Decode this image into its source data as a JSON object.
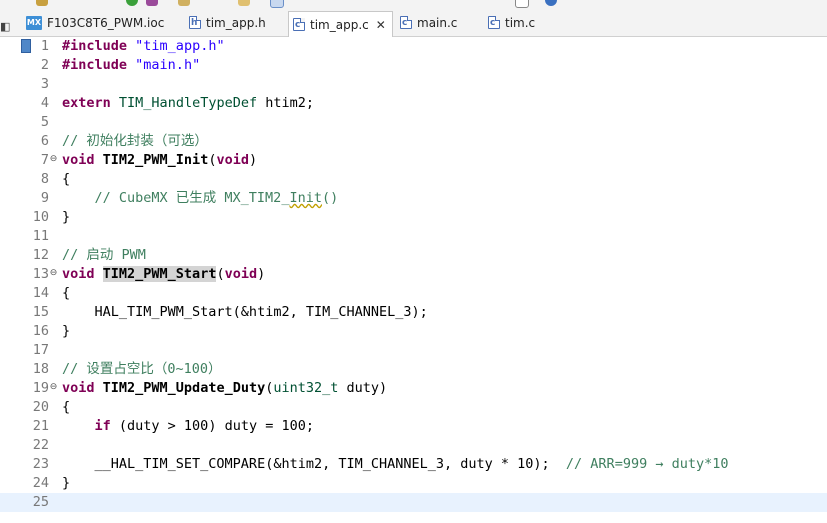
{
  "tabs": [
    {
      "label": "F103C8T6_PWM.ioc",
      "icon": "mx-icon",
      "active": false
    },
    {
      "label": "tim_app.h",
      "icon": "h-file-icon",
      "active": false
    },
    {
      "label": "tim_app.c",
      "icon": "c-file-icon",
      "active": true
    },
    {
      "label": "main.c",
      "icon": "c-file-icon",
      "active": false
    },
    {
      "label": "tim.c",
      "icon": "c-file-icon",
      "active": false
    }
  ],
  "tab_icon_letters": {
    "h": "h",
    "c": "c",
    "mx": "MX"
  },
  "close_glyph": "✕",
  "current_line": 25,
  "colors": {
    "keyword": "#7f0055",
    "string": "#2a00ff",
    "comment": "#3f7f5f",
    "type": "#005032",
    "current_line_bg": "#e8f2fe",
    "highlight_bg": "#d4d4d4"
  },
  "lines": [
    {
      "n": "1",
      "tokens": [
        {
          "t": "#include",
          "c": "kw"
        },
        {
          "t": " "
        },
        {
          "t": "\"tim_app.h\"",
          "c": "str"
        }
      ]
    },
    {
      "n": "2",
      "tokens": [
        {
          "t": "#include",
          "c": "kw"
        },
        {
          "t": " "
        },
        {
          "t": "\"main.h\"",
          "c": "str"
        }
      ]
    },
    {
      "n": "3",
      "tokens": []
    },
    {
      "n": "4",
      "tokens": [
        {
          "t": "extern",
          "c": "kw"
        },
        {
          "t": " "
        },
        {
          "t": "TIM_HandleTypeDef",
          "c": "ty"
        },
        {
          "t": " htim2;"
        }
      ]
    },
    {
      "n": "5",
      "tokens": []
    },
    {
      "n": "6",
      "tokens": [
        {
          "t": "// 初始化封装（可选）",
          "c": "cm"
        }
      ]
    },
    {
      "n": "7",
      "fold": true,
      "tokens": [
        {
          "t": "void",
          "c": "kw"
        },
        {
          "t": " "
        },
        {
          "t": "TIM2_PWM_Init",
          "c": "fn"
        },
        {
          "t": "("
        },
        {
          "t": "void",
          "c": "kw"
        },
        {
          "t": ")"
        }
      ]
    },
    {
      "n": "8",
      "tokens": [
        {
          "t": "{"
        }
      ]
    },
    {
      "n": "9",
      "tokens": [
        {
          "t": "    "
        },
        {
          "t": "// CubeMX 已生成 MX_TIM2_",
          "c": "cm"
        },
        {
          "t": "Init",
          "c": "cm squig"
        },
        {
          "t": "()",
          "c": "cm"
        }
      ]
    },
    {
      "n": "10",
      "tokens": [
        {
          "t": "}"
        }
      ]
    },
    {
      "n": "11",
      "tokens": []
    },
    {
      "n": "12",
      "tokens": [
        {
          "t": "// 启动 PWM",
          "c": "cm"
        }
      ]
    },
    {
      "n": "13",
      "fold": true,
      "tokens": [
        {
          "t": "void",
          "c": "kw"
        },
        {
          "t": " "
        },
        {
          "t": "TIM2_PWM_Start",
          "c": "fn hl"
        },
        {
          "t": "("
        },
        {
          "t": "void",
          "c": "kw"
        },
        {
          "t": ")"
        }
      ]
    },
    {
      "n": "14",
      "tokens": [
        {
          "t": "{"
        }
      ]
    },
    {
      "n": "15",
      "tokens": [
        {
          "t": "    HAL_TIM_PWM_Start(&htim2, TIM_CHANNEL_3);"
        }
      ]
    },
    {
      "n": "16",
      "tokens": [
        {
          "t": "}"
        }
      ]
    },
    {
      "n": "17",
      "tokens": []
    },
    {
      "n": "18",
      "tokens": [
        {
          "t": "// 设置占空比（0~100）",
          "c": "cm"
        }
      ]
    },
    {
      "n": "19",
      "fold": true,
      "tokens": [
        {
          "t": "void",
          "c": "kw"
        },
        {
          "t": " "
        },
        {
          "t": "TIM2_PWM_Update_Duty",
          "c": "fn"
        },
        {
          "t": "("
        },
        {
          "t": "uint32_t",
          "c": "ty"
        },
        {
          "t": " duty)"
        }
      ]
    },
    {
      "n": "20",
      "tokens": [
        {
          "t": "{"
        }
      ]
    },
    {
      "n": "21",
      "tokens": [
        {
          "t": "    "
        },
        {
          "t": "if",
          "c": "kw"
        },
        {
          "t": " (duty > 100) duty = 100;"
        }
      ]
    },
    {
      "n": "22",
      "tokens": []
    },
    {
      "n": "23",
      "tokens": [
        {
          "t": "    __HAL_TIM_SET_COMPARE(&htim2, TIM_CHANNEL_3, duty * 10);  "
        },
        {
          "t": "// ARR=999 → duty*10",
          "c": "cm"
        }
      ]
    },
    {
      "n": "24",
      "tokens": [
        {
          "t": "}"
        }
      ]
    },
    {
      "n": "25",
      "tokens": []
    }
  ]
}
